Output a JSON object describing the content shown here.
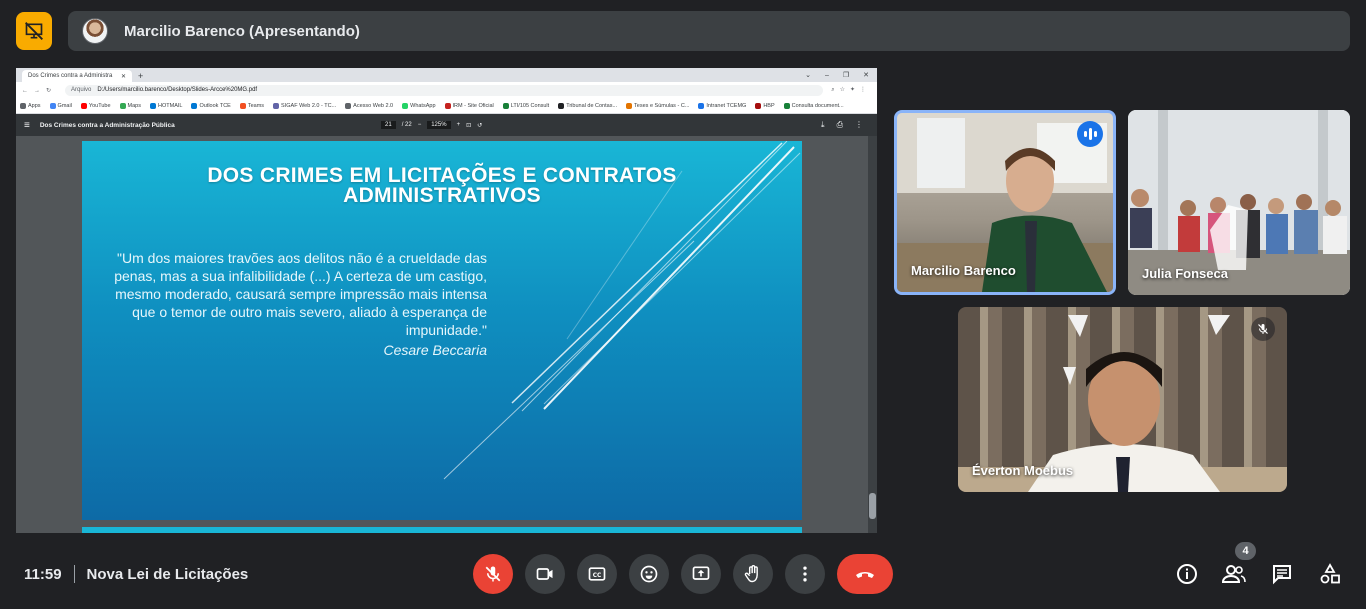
{
  "header": {
    "presenter_label": "Marcilio Barenco (Apresentando)"
  },
  "browser": {
    "tab_title": "Dos Crimes contra a Administra",
    "address_label": "Arquivo",
    "url": "D:/Users/marcilio.barenco/Desktop/Slides-Arcce%20MG.pdf",
    "bookmarks": [
      "Apps",
      "Gmail",
      "YouTube",
      "Maps",
      "HOTMAIL",
      "Outlook TCE",
      "Teams",
      "SIGAF Web 2.0 - TC...",
      "Acesso Web 2.0",
      "WhatsApp",
      "IRM - Site Oficial",
      "LTI/105 Consult",
      "Tribunal de Contas...",
      "Teses e Súmulas - C...",
      "Intranet TCEMG",
      "HBP",
      "Consulta document..."
    ]
  },
  "pdf_viewer": {
    "document_title": "Dos Crimes contra a Administração Pública",
    "current_page": "21",
    "total_pages": "/ 22",
    "zoom": "125%",
    "minus": "−",
    "plus": "+"
  },
  "slide": {
    "title_line1": "DOS CRIMES EM LICITAÇÕES E CONTRATOS",
    "title_line2": "ADMINISTRATIVOS",
    "quote": "\"Um dos maiores travões aos delitos   não é a crueldade das penas, mas a sua infalibilidade (...) A certeza de um castigo, mesmo moderado, causará sempre impressão mais intensa que o temor de outro mais severo, aliado à esperança de impunidade.\"",
    "author": "Cesare Beccaria"
  },
  "participants": [
    {
      "name": "Marcilio Barenco",
      "speaking": true
    },
    {
      "name": "Julia Fonseca",
      "speaking": false
    },
    {
      "name": "Éverton Moebus",
      "muted": true
    }
  ],
  "footer": {
    "time": "11:59",
    "meeting_title": "Nova Lei de Licitações",
    "people_count": "4"
  },
  "colors": {
    "accent_blue": "#8ab4f8",
    "hangup_red": "#ea4335",
    "badge_yellow": "#f9ab00",
    "bar_bg": "#3c4043"
  },
  "icons": [
    "presentation-off-icon",
    "mic-off-icon",
    "camera-icon",
    "captions-icon",
    "emoji-icon",
    "present-screen-icon",
    "raise-hand-icon",
    "more-options-icon",
    "hangup-icon",
    "info-icon",
    "people-icon",
    "chat-icon",
    "activities-icon"
  ]
}
